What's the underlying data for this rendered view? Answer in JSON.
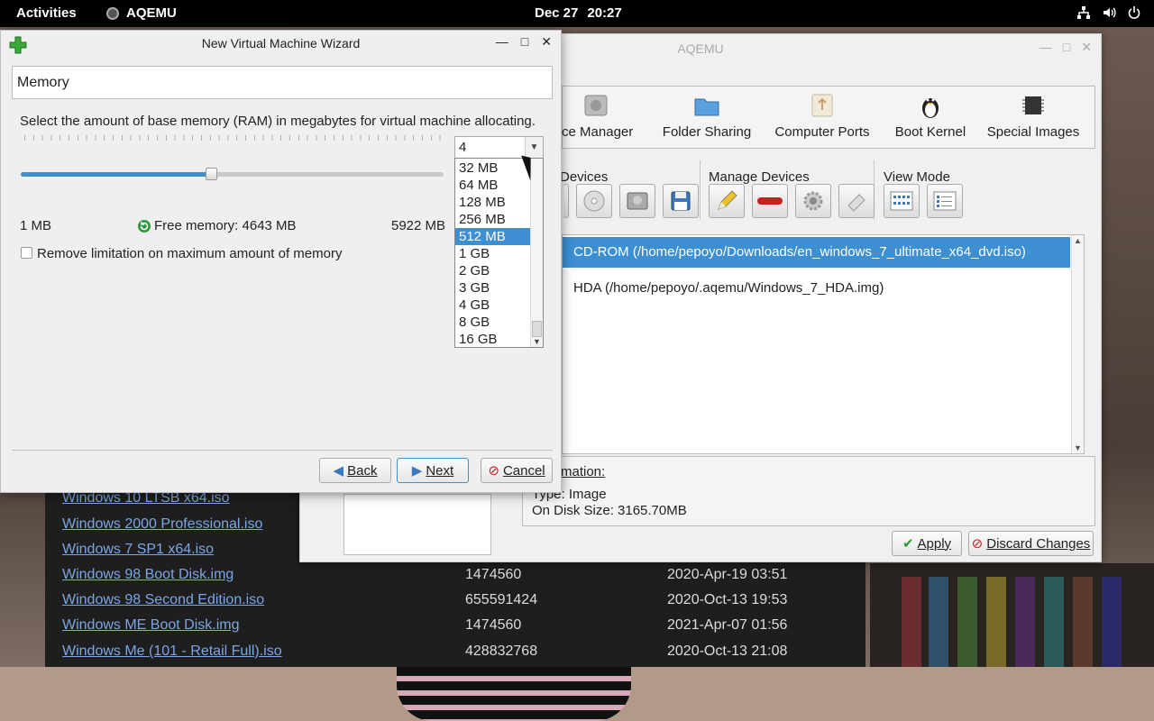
{
  "topbar": {
    "activities": "Activities",
    "app_name": "AQEMU",
    "date": "Dec 27",
    "time": "20:27"
  },
  "filelist": {
    "rows": [
      {
        "name": "Windows 10 LTSB x64.iso",
        "size": "",
        "date": ""
      },
      {
        "name": "Windows 2000 Professional.iso",
        "size": "",
        "date": ""
      },
      {
        "name": "Windows 7 SP1 x64.iso",
        "size": "",
        "date": ""
      },
      {
        "name": "Windows 98 Boot Disk.img",
        "size": "1474560",
        "date": "2020-Apr-19 03:51"
      },
      {
        "name": "Windows 98 Second Edition.iso",
        "size": "655591424",
        "date": "2020-Oct-13 19:53"
      },
      {
        "name": "Windows ME Boot Disk.img",
        "size": "1474560",
        "date": "2021-Apr-07 01:56"
      },
      {
        "name": "Windows Me (101 - Retail Full).iso",
        "size": "428832768",
        "date": "2020-Oct-13 21:08"
      }
    ]
  },
  "aqemu": {
    "title": "AQEMU",
    "toolbar": [
      {
        "label": "ice Manager",
        "icon": "device-manager-icon"
      },
      {
        "label": "Folder Sharing",
        "icon": "folder-icon"
      },
      {
        "label": "Computer Ports",
        "icon": "usb-icon"
      },
      {
        "label": "Boot Kernel",
        "icon": "tux-icon"
      },
      {
        "label": "Special Images",
        "icon": "chip-icon"
      }
    ],
    "sections": {
      "devices": "Devices",
      "manage_devices": "Manage Devices",
      "view_mode": "View Mode"
    },
    "devices": [
      "CD-ROM (/home/pepoyo/Downloads/en_windows_7_ultimate_x64_dvd.iso)",
      "HDA (/home/pepoyo/.aqemu/Windows_7_HDA.img)"
    ],
    "info": {
      "heading": "mation:",
      "type": "Type: Image",
      "size": "On Disk Size: 3165.70MB"
    },
    "apply": "Apply",
    "discard": "Discard Changes"
  },
  "wizard": {
    "title": "New Virtual Machine Wizard",
    "page": "Memory",
    "description": "Select the amount of base memory (RAM) in megabytes for virtual machine allocating.",
    "combo_value": "4",
    "slider_fraction": 0.45,
    "min_label": "1 MB",
    "free_memory": "Free memory: 4643 MB",
    "max_label": "5922 MB",
    "checkbox_label": "Remove limitation on maximum amount of memory",
    "options": [
      "32 MB",
      "64 MB",
      "128 MB",
      "256 MB",
      "512 MB",
      "1 GB",
      "2 GB",
      "3 GB",
      "4 GB",
      "8 GB",
      "16 GB"
    ],
    "selected_option": "512 MB",
    "back": "Back",
    "next": "Next",
    "cancel": "Cancel"
  },
  "colors": {
    "accent": "#3d8fd1",
    "link": "#7ca6e6"
  }
}
